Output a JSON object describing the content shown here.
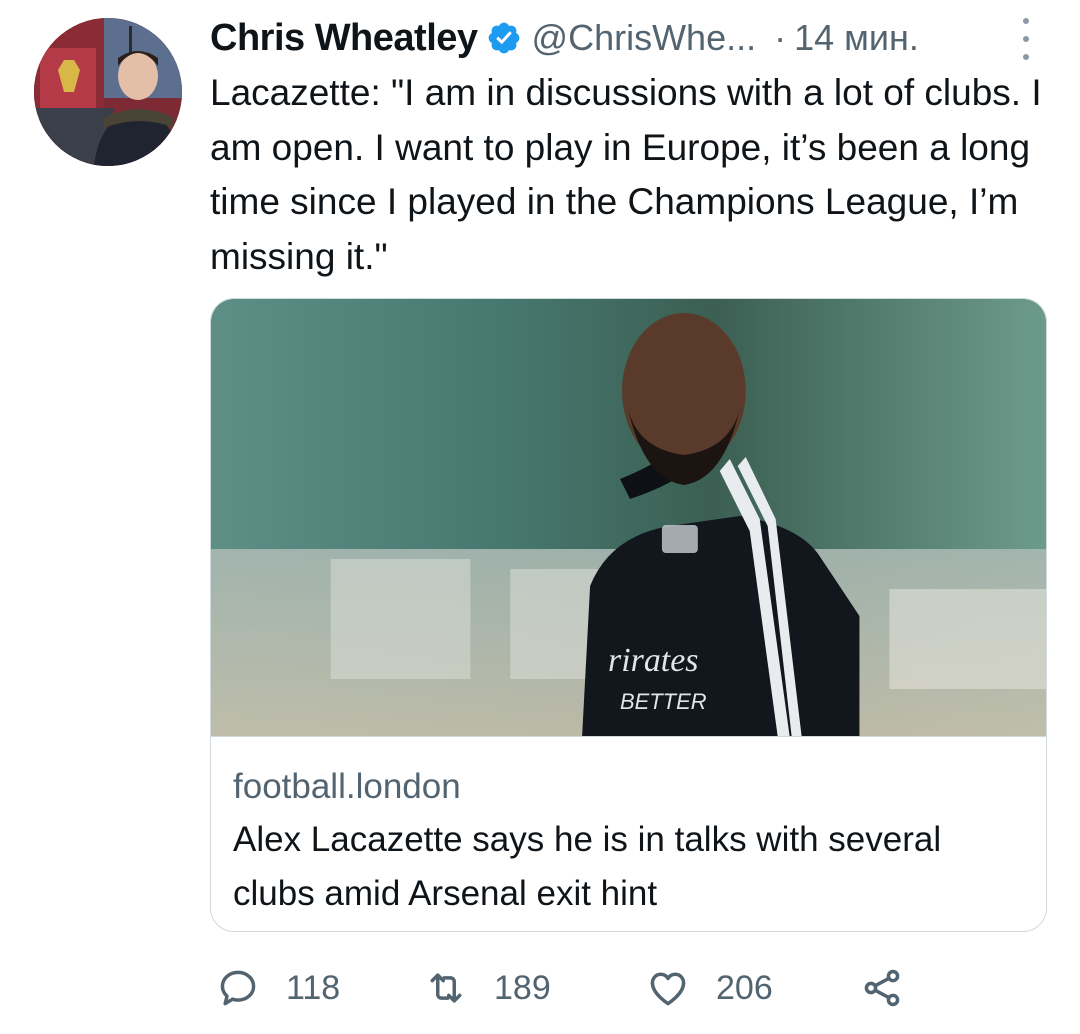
{
  "author": {
    "name": "Chris Wheatley",
    "handle": "@ChrisWhe...",
    "separator": "·",
    "time": "14 мин.",
    "verified": true,
    "verified_color": "#1d9bf0"
  },
  "tweet": {
    "text": "Lacazette: \"I am in discussions with a lot of clubs. I am open. I want to play in Europe, it’s been a long time since I played in the Champions League, I’m missing it.\""
  },
  "card": {
    "domain": "football.london",
    "title": "Alex Lacazette says he is in talks with several clubs amid Arsenal exit hint"
  },
  "actions": {
    "reply": {
      "icon": "reply-icon",
      "count": "118"
    },
    "retweet": {
      "icon": "retweet-icon",
      "count": "189"
    },
    "like": {
      "icon": "heart-icon",
      "count": "206"
    },
    "share": {
      "icon": "share-icon"
    }
  },
  "colors": {
    "text_primary": "#0f1419",
    "text_secondary": "#536471",
    "border": "#cfd9de",
    "accent": "#1d9bf0"
  }
}
